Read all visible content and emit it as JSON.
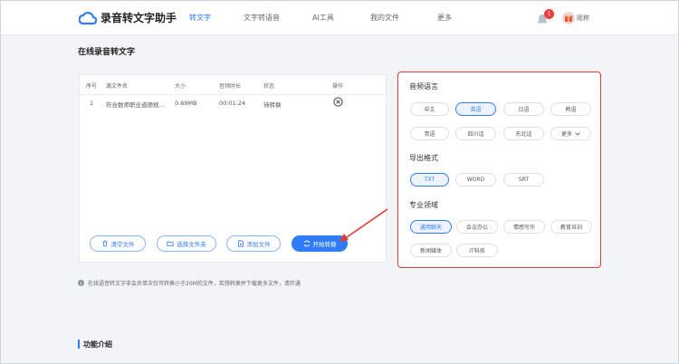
{
  "header": {
    "app_title": "录音转文字助手",
    "nav": [
      {
        "label": "转文字",
        "active": true
      },
      {
        "label": "文字转语音",
        "active": false
      },
      {
        "label": "AI工具",
        "active": false
      },
      {
        "label": "我的文件",
        "active": false
      },
      {
        "label": "更多",
        "active": false
      }
    ],
    "notification_count": "1",
    "username": "昵称",
    "icons": {
      "logo": "cloud-icon",
      "bell": "bell-icon",
      "avatar": "gift-avatar-icon"
    }
  },
  "page_title": "在线录音转文字",
  "file_table": {
    "headers": [
      "序号",
      "源文件名",
      "大小",
      "音频时长",
      "状态",
      "操作"
    ],
    "rows": [
      {
        "index": "1",
        "name": "符合数师职业道德规...",
        "size": "0.69MB",
        "duration": "00:01:24",
        "status": "待转换"
      }
    ]
  },
  "buttons": {
    "clear": "清空文件",
    "choose_folder": "选择文件夹",
    "add_file": "添加文件",
    "start": "开始转换"
  },
  "settings": {
    "language_title": "音频语言",
    "languages": [
      "中文",
      "英语",
      "日语",
      "韩语",
      "粤语",
      "四川话",
      "东北话",
      "更多"
    ],
    "selected_language": "英语",
    "format_title": "导出格式",
    "formats": [
      "TXT",
      "WORD",
      "SRT"
    ],
    "selected_format": "TXT",
    "domain_title": "专业领域",
    "domains": [
      "通用聊天",
      "会议办公",
      "情感写作",
      "教育培训",
      "新闻媒体",
      "IT科技"
    ],
    "selected_domain": "通用聊天"
  },
  "notice": "在线语音转文字非会员单次仅可转换小于20M的文件，若想转换并下载更多文件，请开通",
  "intro_title": "功能介绍",
  "colors": {
    "accent": "#2f7cf6",
    "highlight_border": "#e23b36",
    "badge": "#f23b3b"
  }
}
